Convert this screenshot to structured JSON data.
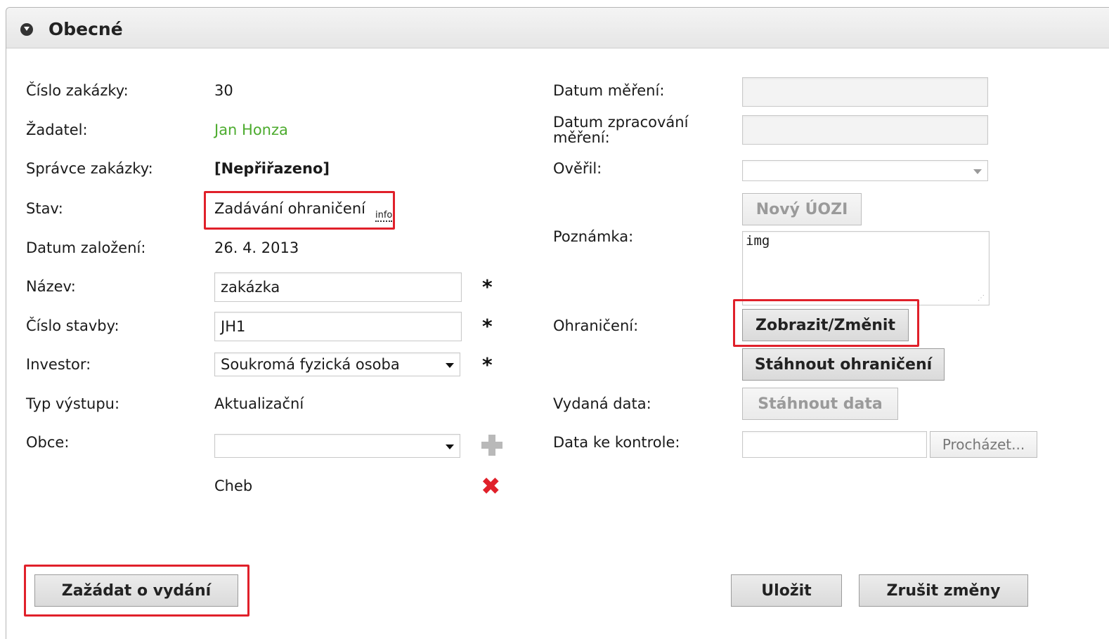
{
  "panel": {
    "title": "Obecné",
    "icon": "collapse-toggle-icon"
  },
  "left": {
    "order_number": {
      "label": "Číslo zakázky:",
      "value": "30"
    },
    "applicant": {
      "label": "Žadatel:",
      "value": "Jan Honza"
    },
    "order_manager": {
      "label": "Správce zakázky:",
      "value": "[Nepřiřazeno]"
    },
    "status": {
      "label": "Stav:",
      "value": "Zadávání ohraničení",
      "info_link": "info"
    },
    "created_date": {
      "label": "Datum založení:",
      "value": "26. 4. 2013"
    },
    "name": {
      "label": "Název:",
      "value": "zakázka",
      "required": "*"
    },
    "building_number": {
      "label": "Číslo stavby:",
      "value": "JH1",
      "required": "*"
    },
    "investor": {
      "label": "Investor:",
      "value": "Soukromá fyzická osoba",
      "required": "*"
    },
    "output_type": {
      "label": "Typ výstupu:",
      "value": "Aktualizační"
    },
    "municipalities": {
      "label": "Obce:",
      "value": "",
      "items": [
        "Cheb"
      ]
    }
  },
  "right": {
    "measurement_date": {
      "label": "Datum měření:",
      "value": ""
    },
    "processing_date": {
      "label_line1": "Datum zpracování",
      "label_line2": "měření:",
      "value": ""
    },
    "verified_by": {
      "label": "Ověřil:",
      "value": ""
    },
    "new_uozi_button": "Nový ÚOZI",
    "note": {
      "label": "Poznámka:",
      "value": "img"
    },
    "boundary": {
      "label": "Ohraničení:",
      "show_change_button": "Zobrazit/Změnit",
      "download_button": "Stáhnout ohraničení"
    },
    "issued_data": {
      "label": "Vydaná data:",
      "download_button": "Stáhnout data"
    },
    "data_to_check": {
      "label": "Data ke kontrole:",
      "value": "",
      "browse_button": "Procházet..."
    }
  },
  "footer": {
    "request_issue_button": "Zažádat o vydání",
    "save_button": "Uložit",
    "cancel_changes_button": "Zrušit změny"
  },
  "colors": {
    "highlight": "#e0202a",
    "applicant_link": "#4cab2e"
  }
}
